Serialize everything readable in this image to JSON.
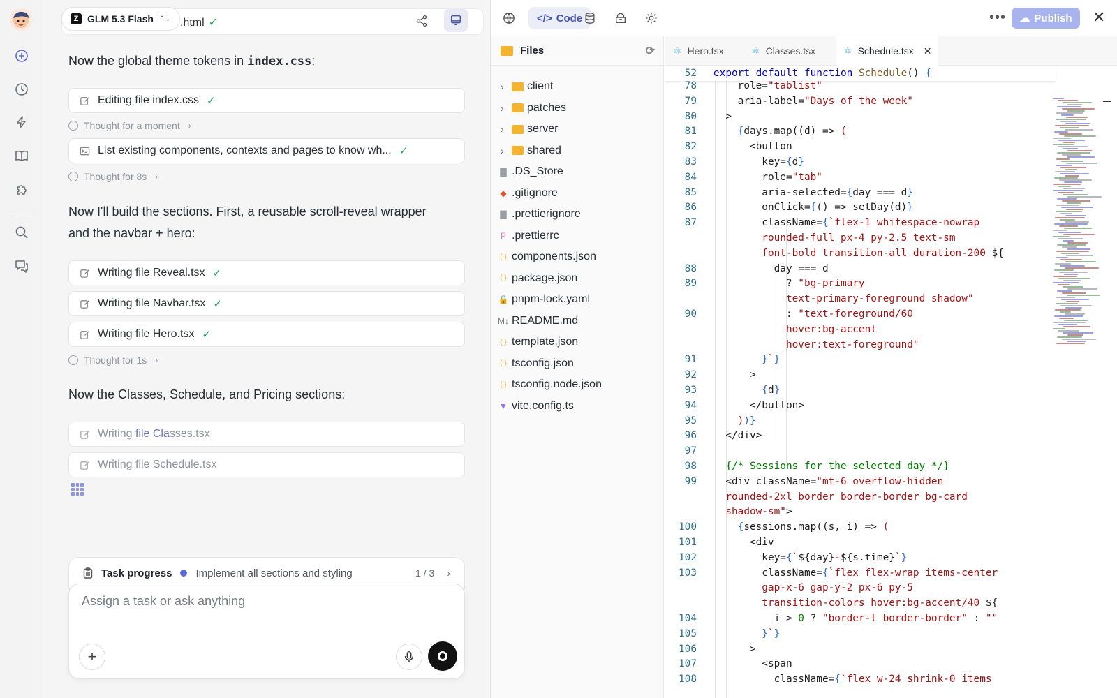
{
  "chat": {
    "model": "GLM 5.3 Flash",
    "top_file": ".html",
    "messages": {
      "theme": "Now the global theme tokens in ",
      "theme_code": "index.css",
      "theme_colon": ":",
      "sections_1": "Now I'll build the sections. First, a reusable scroll-reveal wrapper",
      "sections_2": "and the navbar + hero:",
      "classes": "Now the Classes, Schedule, and Pricing sections:"
    },
    "tools": {
      "edit_css": "Editing file index.css",
      "list": "List existing components, contexts and pages to know wh...",
      "reveal": "Writing file Reveal.tsx",
      "navbar": "Writing file Navbar.tsx",
      "hero": "Writing file Hero.tsx",
      "classes_pre": "Writing ",
      "classes_hl": "file Cla",
      "classes_post": "sses.tsx",
      "schedule": "Writing file Schedule.tsx"
    },
    "thoughts": {
      "t1": "Thought for a moment",
      "t2": "Thought for 8s",
      "t3": "Thought for 1s"
    },
    "task": {
      "label": "Task progress",
      "current": "Implement all sections and styling",
      "count": "1 / 3"
    },
    "composer": {
      "placeholder": "Assign a task or ask anything"
    }
  },
  "workspace": {
    "code_tab": "Code",
    "publish": "Publish",
    "files_header": "Files",
    "tree": [
      {
        "name": "client",
        "type": "folder"
      },
      {
        "name": "patches",
        "type": "folder"
      },
      {
        "name": "server",
        "type": "folder"
      },
      {
        "name": "shared",
        "type": "folder"
      },
      {
        "name": ".DS_Store",
        "type": "file",
        "icon": "file-icon",
        "color": "#9a9ea5"
      },
      {
        "name": ".gitignore",
        "type": "file",
        "icon": "git-icon",
        "color": "#e5532d"
      },
      {
        "name": ".prettierignore",
        "type": "file",
        "icon": "file-icon",
        "color": "#9a9ea5"
      },
      {
        "name": ".prettierrc",
        "type": "file",
        "icon": "prettier-icon",
        "color": "#e77fd1"
      },
      {
        "name": "components.json",
        "type": "file",
        "icon": "json-icon",
        "color": "#e0b23a"
      },
      {
        "name": "package.json",
        "type": "file",
        "icon": "json-icon",
        "color": "#e0b23a"
      },
      {
        "name": "pnpm-lock.yaml",
        "type": "file",
        "icon": "lock-icon",
        "color": "#f0b429"
      },
      {
        "name": "README.md",
        "type": "file",
        "icon": "markdown-icon",
        "color": "#7a7e85"
      },
      {
        "name": "template.json",
        "type": "file",
        "icon": "json-icon",
        "color": "#e0b23a"
      },
      {
        "name": "tsconfig.json",
        "type": "file",
        "icon": "json-icon",
        "color": "#e0b23a"
      },
      {
        "name": "tsconfig.node.json",
        "type": "file",
        "icon": "json-icon",
        "color": "#e0b23a"
      },
      {
        "name": "vite.config.ts",
        "type": "file",
        "icon": "vite-icon",
        "color": "#9b6cf0"
      }
    ],
    "tabs": [
      {
        "name": "Hero.tsx",
        "active": false
      },
      {
        "name": "Classes.tsx",
        "active": false
      },
      {
        "name": "Schedule.tsx",
        "active": true
      }
    ],
    "sticky_line": {
      "num": "52",
      "parts": [
        [
          "k",
          "export default function "
        ],
        [
          "fn",
          "Schedule"
        ],
        [
          "",
          "() "
        ],
        [
          "br",
          "{"
        ]
      ]
    },
    "code_lines": [
      {
        "num": "78",
        "indent": 0,
        "parts": [
          [
            "",
            "    role="
          ],
          [
            "s",
            "\"tablist\""
          ]
        ]
      },
      {
        "num": "79",
        "parts": [
          [
            "",
            "    aria-label="
          ],
          [
            "s",
            "\"Days of the week\""
          ]
        ]
      },
      {
        "num": "80",
        "parts": [
          [
            "",
            "  >"
          ]
        ]
      },
      {
        "num": "81",
        "parts": [
          [
            "",
            "    "
          ],
          [
            "br",
            "{"
          ],
          [
            "",
            "days.map(("
          ],
          [
            "",
            "d) => "
          ],
          [
            "s",
            "("
          ]
        ]
      },
      {
        "num": "82",
        "parts": [
          [
            "",
            "      <button"
          ]
        ]
      },
      {
        "num": "83",
        "parts": [
          [
            "",
            "        key="
          ],
          [
            "br",
            "{"
          ],
          [
            "",
            "d"
          ],
          [
            "br",
            "}"
          ]
        ]
      },
      {
        "num": "84",
        "parts": [
          [
            "",
            "        role="
          ],
          [
            "s",
            "\"tab\""
          ]
        ]
      },
      {
        "num": "85",
        "parts": [
          [
            "",
            "        aria-selected="
          ],
          [
            "br",
            "{"
          ],
          [
            "",
            "day === d"
          ],
          [
            "br",
            "}"
          ]
        ]
      },
      {
        "num": "86",
        "parts": [
          [
            "",
            "        onClick="
          ],
          [
            "br",
            "{"
          ],
          [
            "",
            "() => setDay(d)"
          ],
          [
            "br",
            "}"
          ]
        ]
      },
      {
        "num": "87",
        "parts": [
          [
            "",
            "        className="
          ],
          [
            "br",
            "{"
          ],
          [
            "s",
            "`flex-1 whitespace-nowrap"
          ]
        ]
      },
      {
        "num": "",
        "parts": [
          [
            "s",
            "        rounded-full px-4 py-2.5 text-sm"
          ]
        ]
      },
      {
        "num": "",
        "parts": [
          [
            "s",
            "        font-bold transition-all duration-200 "
          ],
          [
            "",
            "${"
          ]
        ]
      },
      {
        "num": "88",
        "parts": [
          [
            "",
            "          day === d"
          ]
        ]
      },
      {
        "num": "89",
        "parts": [
          [
            "",
            "            ? "
          ],
          [
            "s",
            "\"bg-primary"
          ]
        ]
      },
      {
        "num": "",
        "parts": [
          [
            "s",
            "            text-primary-foreground shadow\""
          ]
        ]
      },
      {
        "num": "90",
        "parts": [
          [
            "",
            "            : "
          ],
          [
            "s",
            "\"text-foreground/60"
          ]
        ]
      },
      {
        "num": "",
        "parts": [
          [
            "s",
            "            hover:bg-accent"
          ]
        ]
      },
      {
        "num": "",
        "parts": [
          [
            "s",
            "            hover:text-foreground\""
          ]
        ]
      },
      {
        "num": "91",
        "parts": [
          [
            "br",
            "        }"
          ],
          [
            "s",
            "`"
          ],
          [
            "br",
            "}"
          ]
        ]
      },
      {
        "num": "92",
        "parts": [
          [
            "",
            "      >"
          ]
        ]
      },
      {
        "num": "93",
        "parts": [
          [
            "",
            "        "
          ],
          [
            "br",
            "{"
          ],
          [
            "",
            "d"
          ],
          [
            "br",
            "}"
          ]
        ]
      },
      {
        "num": "94",
        "parts": [
          [
            "",
            "      </button>"
          ]
        ]
      },
      {
        "num": "95",
        "parts": [
          [
            "",
            "    "
          ],
          [
            "s",
            ")"
          ],
          [
            "br",
            ")}"
          ]
        ]
      },
      {
        "num": "96",
        "parts": [
          [
            "",
            "  </div>"
          ]
        ]
      },
      {
        "num": "97",
        "parts": [
          [
            "",
            ""
          ]
        ]
      },
      {
        "num": "98",
        "parts": [
          [
            "cm",
            "  {/* Sessions for the selected day */}"
          ]
        ]
      },
      {
        "num": "99",
        "parts": [
          [
            "",
            "  <div className="
          ],
          [
            "s",
            "\"mt-6 overflow-hidden"
          ]
        ]
      },
      {
        "num": "",
        "parts": [
          [
            "s",
            "  rounded-2xl border border-border bg-card"
          ]
        ]
      },
      {
        "num": "",
        "parts": [
          [
            "s",
            "  shadow-sm\""
          ],
          [
            "",
            ">"
          ]
        ]
      },
      {
        "num": "100",
        "parts": [
          [
            "",
            "    "
          ],
          [
            "br",
            "{"
          ],
          [
            "",
            "sessions.map(("
          ],
          [
            "",
            "s, i) => "
          ],
          [
            "s",
            "("
          ]
        ]
      },
      {
        "num": "101",
        "parts": [
          [
            "",
            "      <div"
          ]
        ]
      },
      {
        "num": "102",
        "parts": [
          [
            "",
            "        key="
          ],
          [
            "br",
            "{"
          ],
          [
            "s",
            "`"
          ],
          [
            "",
            "${day}"
          ],
          [
            "s",
            "-"
          ],
          [
            "",
            "${s.time}"
          ],
          [
            "s",
            "`"
          ],
          [
            "br",
            "}"
          ]
        ]
      },
      {
        "num": "103",
        "parts": [
          [
            "",
            "        className="
          ],
          [
            "br",
            "{"
          ],
          [
            "s",
            "`flex flex-wrap items-center"
          ]
        ]
      },
      {
        "num": "",
        "parts": [
          [
            "s",
            "        gap-x-6 gap-y-2 px-6 py-5"
          ]
        ]
      },
      {
        "num": "",
        "parts": [
          [
            "s",
            "        transition-colors hover:bg-accent/40 "
          ],
          [
            "",
            "${"
          ]
        ]
      },
      {
        "num": "104",
        "parts": [
          [
            "",
            "          i > "
          ],
          [
            "cm",
            "0"
          ],
          [
            "",
            " ? "
          ],
          [
            "s",
            "\"border-t border-border\""
          ],
          [
            "",
            " : "
          ],
          [
            "s",
            "\"\""
          ]
        ]
      },
      {
        "num": "105",
        "parts": [
          [
            "br",
            "        }"
          ],
          [
            "s",
            "`"
          ],
          [
            "br",
            "}"
          ]
        ]
      },
      {
        "num": "106",
        "parts": [
          [
            "",
            "      >"
          ]
        ]
      },
      {
        "num": "107",
        "parts": [
          [
            "",
            "        <span"
          ]
        ]
      },
      {
        "num": "108",
        "parts": [
          [
            "",
            "          className="
          ],
          [
            "br",
            "{"
          ],
          [
            "s",
            "`flex w-24 shrink-0 items"
          ]
        ]
      }
    ]
  }
}
